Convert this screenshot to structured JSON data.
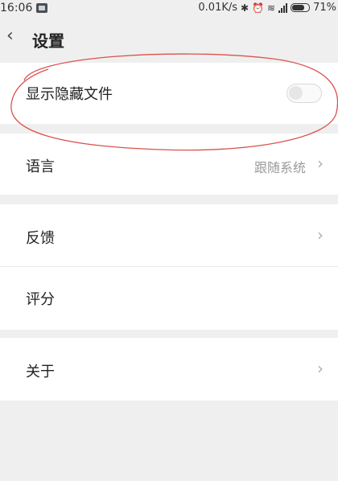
{
  "status_bar": {
    "time": "16:06",
    "net_speed": "0.01K/s",
    "battery_percent": "71%",
    "icons": [
      "message-icon",
      "bluetooth-icon",
      "alarm-icon",
      "wifi-icon",
      "signal-icon",
      "battery-icon"
    ]
  },
  "header": {
    "back_icon": "‹",
    "title": "设置"
  },
  "settings": {
    "show_hidden_files": {
      "label": "显示隐藏文件",
      "enabled": false
    },
    "language": {
      "label": "语言",
      "value": "跟随系统"
    },
    "feedback": {
      "label": "反馈"
    },
    "rate": {
      "label": "评分"
    },
    "about": {
      "label": "关于"
    }
  },
  "chevron": "›",
  "annotation_color": "#d9534f"
}
